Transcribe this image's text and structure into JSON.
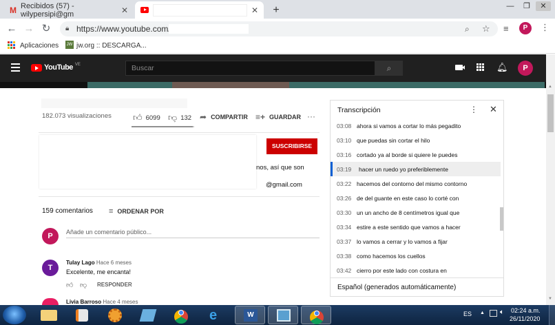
{
  "browser": {
    "tabs": [
      {
        "label": "Recibidos (57) - wilypersipi@gm"
      },
      {
        "label": ""
      }
    ],
    "new_tab": "+",
    "url": "https://www.youtube.com/",
    "profile_initial": "P",
    "bookmarks": [
      {
        "label": "Aplicaciones"
      },
      {
        "label": "jw.org :: DESCARGA..."
      }
    ],
    "window_controls": [
      "—",
      "❐",
      "✕"
    ]
  },
  "youtube": {
    "logo_text": "YouTube",
    "logo_region": "VE",
    "search_placeholder": "Buscar",
    "avatar_initial": "P",
    "views": "182.073 visualizaciones",
    "likes": "6099",
    "dislikes": "132",
    "share_label": "COMPARTIR",
    "save_label": "GUARDAR",
    "more": "···",
    "subscribe_label": "SUSCRIBIRSE",
    "desc_line1": "nos, así que son",
    "desc_line2": "@gmail.com",
    "comments_count": "159 comentarios",
    "sort_label": "ORDENAR POR",
    "add_comment_placeholder": "Añade un comentario público...",
    "comments": [
      {
        "initial": "T",
        "author": "Tulay Lago",
        "time": "Hace 6 meses",
        "text": "Excelente, me encanta!",
        "reply": "RESPONDER",
        "color": "#6a1b9a"
      },
      {
        "initial": "",
        "author": "Livia Barroso",
        "time": "Hace 4 meses",
        "text": "",
        "reply": "",
        "color": "#e91e63"
      }
    ]
  },
  "transcript": {
    "title": "Transcripción",
    "language": "Español (generados automáticamente)",
    "rows": [
      {
        "time": "03:08",
        "text": "ahora si vamos a cortar lo más pegadito"
      },
      {
        "time": "03:10",
        "text": "que puedas sin cortar el hilo"
      },
      {
        "time": "03:16",
        "text": "cortado ya al borde si quiere le puedes"
      },
      {
        "time": "03:19",
        "text": "hacer un ruedo yo preferiblemente"
      },
      {
        "time": "03:22",
        "text": "hacemos del contorno del mismo contorno"
      },
      {
        "time": "03:26",
        "text": "de del guante en este caso lo corté con"
      },
      {
        "time": "03:30",
        "text": "un un ancho de 8 centímetros igual que"
      },
      {
        "time": "03:34",
        "text": "estire a este sentido que vamos a hacer"
      },
      {
        "time": "03:37",
        "text": "lo vamos a cerrar y lo vamos a fijar"
      },
      {
        "time": "03:38",
        "text": "como hacemos los cuellos"
      },
      {
        "time": "03:42",
        "text": "cierro por este lado con costura en"
      }
    ],
    "highlighted_index": 3
  },
  "taskbar": {
    "lang": "ES",
    "time": "02:24 a.m.",
    "date": "26/11/2020"
  },
  "colors": {
    "yt_red": "#ff0000",
    "subscribe_red": "#cc0000",
    "avatar_red": "#c2185b",
    "highlight_blue": "#065fd4"
  }
}
